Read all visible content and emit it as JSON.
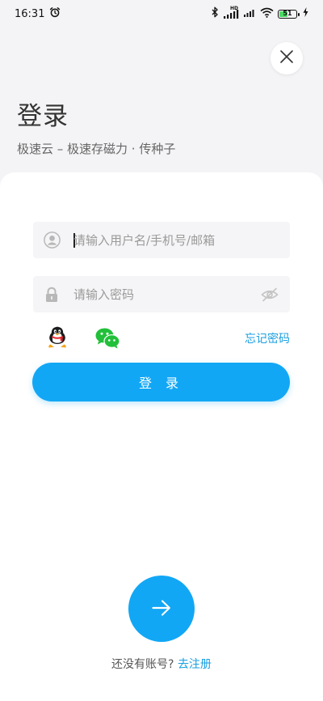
{
  "status_bar": {
    "time": "16:31",
    "network_label": "HD",
    "battery_level": "51",
    "battery_percent": 51
  },
  "header": {
    "title": "登录",
    "subtitle": "极速云 – 极速存磁力 · 传种子"
  },
  "form": {
    "username_placeholder": "请输入用户名/手机号/邮箱",
    "password_placeholder": "请输入密码",
    "forgot_password": "忘记密码",
    "login_button": "登 录"
  },
  "footer": {
    "no_account": "还没有账号?",
    "register": "去注册"
  },
  "colors": {
    "accent": "#12a7f5",
    "link": "#1a9fe0",
    "wechat": "#22c03a",
    "battery": "#4cd964"
  }
}
